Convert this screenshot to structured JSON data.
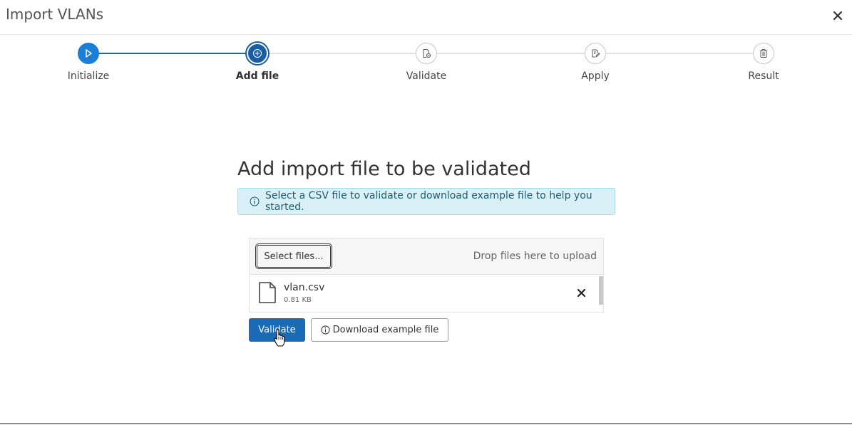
{
  "dialog": {
    "title": "Import VLANs",
    "close_icon": "close-icon"
  },
  "stepper": {
    "steps": [
      {
        "label": "Initialize",
        "icon": "play-icon",
        "state": "done"
      },
      {
        "label": "Add file",
        "icon": "plus-circle-icon",
        "state": "current"
      },
      {
        "label": "Validate",
        "icon": "file-check-icon",
        "state": "pending"
      },
      {
        "label": "Apply",
        "icon": "edit-document-icon",
        "state": "pending"
      },
      {
        "label": "Result",
        "icon": "clipboard-icon",
        "state": "pending"
      }
    ]
  },
  "main": {
    "title": "Add import file to be validated",
    "info_text": "Select a CSV file to validate or download example file to help you started."
  },
  "upload": {
    "select_button": "Select files...",
    "drop_hint": "Drop files here to upload",
    "files": [
      {
        "name": "vlan.csv",
        "size": "0.81 KB"
      }
    ]
  },
  "actions": {
    "validate_label": "Validate",
    "download_label": "Download example file"
  },
  "colors": {
    "primary": "#1a6bb5",
    "step_done": "#1c7fd6",
    "step_current": "#195da3",
    "info_bg": "#d9f1f6",
    "info_text": "#1d5d70"
  }
}
